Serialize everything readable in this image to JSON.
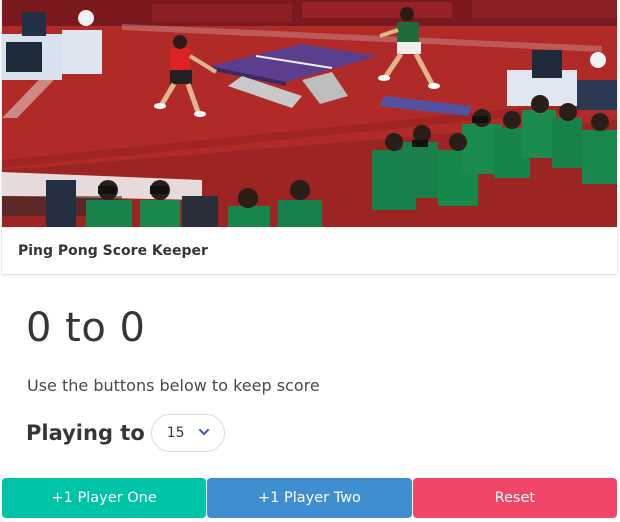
{
  "card": {
    "title": "Ping Pong Score Keeper"
  },
  "score": {
    "display": "0 to 0"
  },
  "instructions": "Use the buttons below to keep score",
  "playing_to": {
    "label": "Playing to",
    "selected": "15"
  },
  "buttons": {
    "player_one": "+1 Player One",
    "player_two": "+1 Player Two",
    "reset": "Reset"
  },
  "colors": {
    "player_one": "#00c4a7",
    "player_two": "#3e8ed0",
    "reset": "#f14668",
    "chevron": "#485fc7",
    "court": "#b22a26"
  },
  "icons": {
    "select_arrow": "chevron-down-icon"
  }
}
